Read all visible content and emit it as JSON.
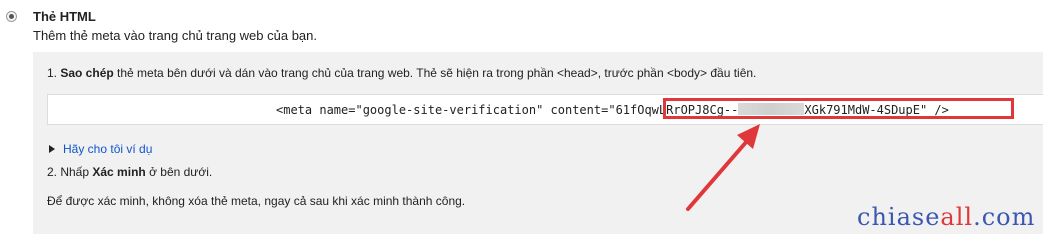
{
  "option": {
    "title": "Thẻ HTML",
    "description": "Thêm thẻ meta vào trang chủ trang web của bạn."
  },
  "steps": {
    "step1_prefix": "1. ",
    "step1_bold": "Sao chép",
    "step1_rest": " thẻ meta bên dưới và dán vào trang chủ của trang web. Thẻ sẽ hiện ra trong phần <head>, trước phần <body> đầu tiên.",
    "meta_tag_start": "<meta name=\"google-site-verification\" content=\"",
    "meta_value_visible_start": "61fOqwLRrOPJ8Cg--",
    "meta_value_visible_end": "XGk791MdW-4SDupE",
    "meta_tag_end": "\" />",
    "example_link": "Hãy cho tôi ví dụ",
    "step2_prefix": "2. Nhấp ",
    "step2_bold": "Xác minh",
    "step2_rest": " ở bên dưới.",
    "note": "Để được xác minh, không xóa thẻ meta, ngay cả sau khi xác minh thành công."
  },
  "watermark": {
    "part1": "chiase",
    "part2": "all",
    "part3": ".com"
  },
  "colors": {
    "highlight": "#e0383a",
    "link": "#1155cc",
    "panel": "#f1f1f1"
  }
}
